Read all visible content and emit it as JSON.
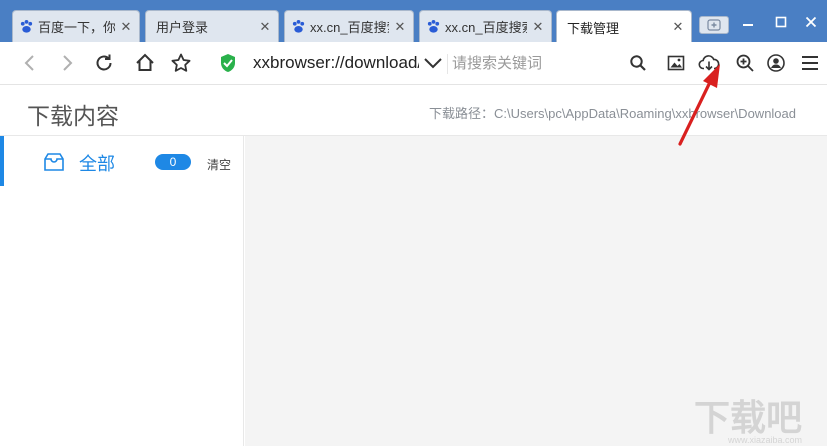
{
  "tabs": [
    {
      "title": "百度一下，你",
      "favicon": "baidu-paw-icon",
      "active": false
    },
    {
      "title": "用户登录",
      "favicon": "",
      "active": false
    },
    {
      "title": "xx.cn_百度搜索",
      "favicon": "baidu-paw-icon",
      "active": false
    },
    {
      "title": "xx.cn_百度搜索",
      "favicon": "baidu-paw-icon",
      "active": false
    },
    {
      "title": "下载管理",
      "favicon": "",
      "active": true
    }
  ],
  "toolbar": {
    "url": "xxbrowser://download/",
    "search_placeholder": "请搜索关键词"
  },
  "page": {
    "title": "下载内容",
    "path_label": "下载路径：",
    "path_value": "C:\\Users\\pc\\AppData\\Roaming\\xxbrowser\\Download"
  },
  "sidebar": {
    "items": [
      {
        "label": "全部",
        "count": "0",
        "action": "清空",
        "icon": "inbox-icon"
      }
    ]
  },
  "watermark": {
    "text": "下载吧",
    "url": "www.xiazaiba.com"
  },
  "colors": {
    "accent": "#1e88e5",
    "tabbar": "#4a7fc4",
    "content_bg": "#f4f4f4",
    "annotation_arrow": "#d9201f"
  }
}
